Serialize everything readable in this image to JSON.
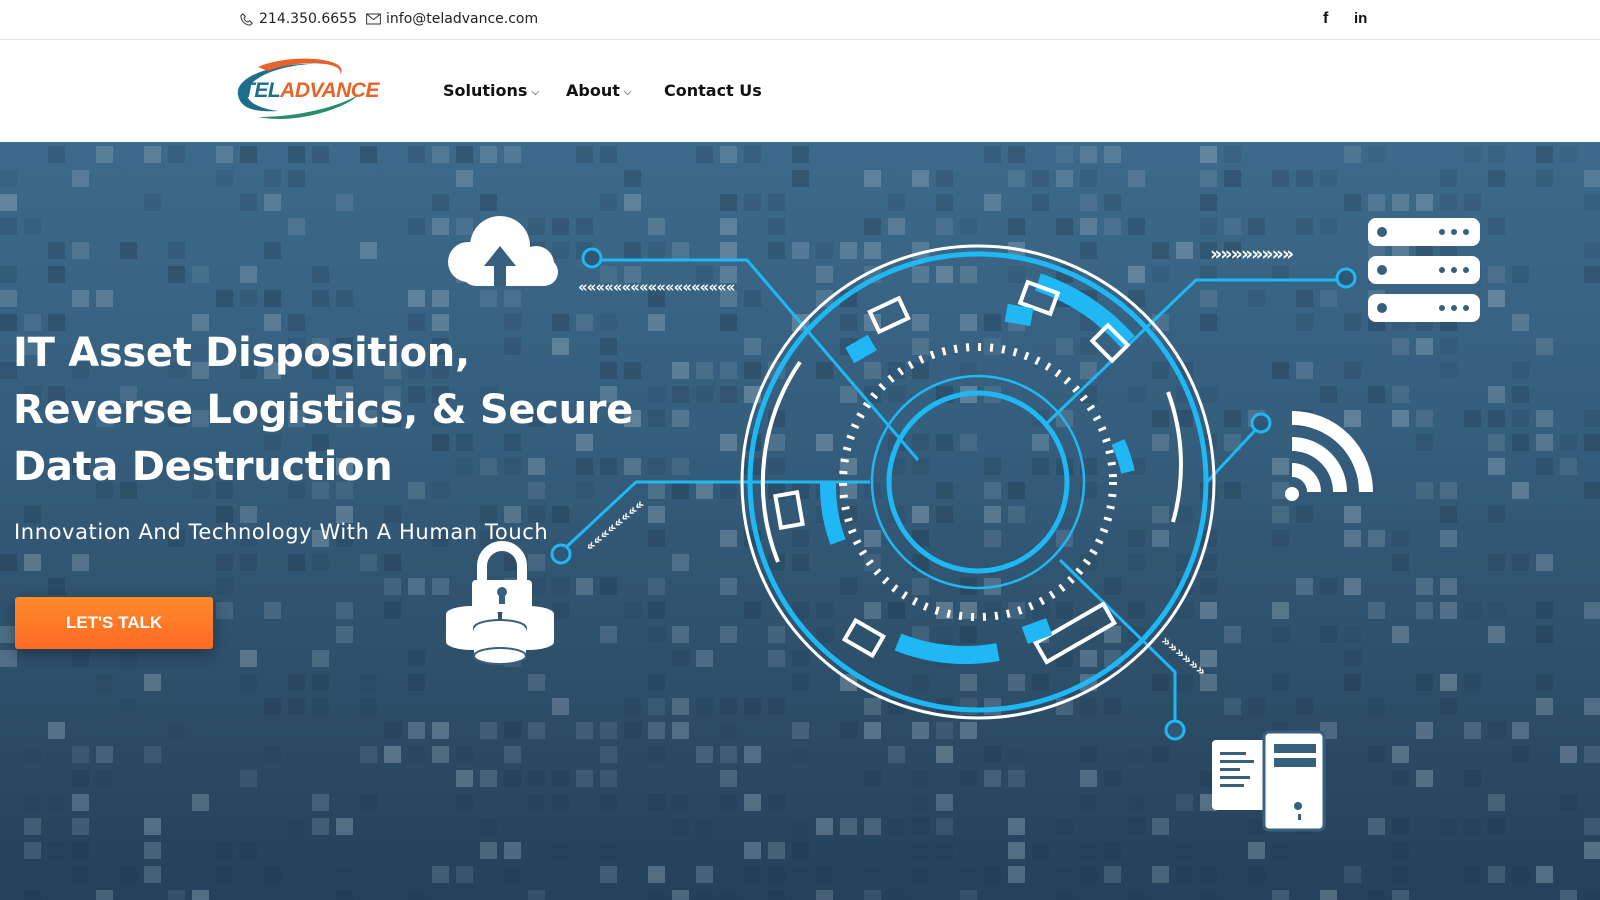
{
  "topbar": {
    "phone": "214.350.6655",
    "email": "info@teladvance.com",
    "social": {
      "facebook_glyph": "f",
      "linkedin_glyph": "in"
    }
  },
  "logo": {
    "tel": "TEL",
    "advance": "ADVANCE"
  },
  "nav": {
    "items": [
      {
        "label": "Solutions",
        "has_dropdown": true
      },
      {
        "label": "About",
        "has_dropdown": true
      },
      {
        "label": "Contact Us",
        "has_dropdown": false
      }
    ],
    "chevron_glyph": "⌵"
  },
  "hero": {
    "title": "IT Asset Disposition, Reverse Logistics, & Secure Data Destruction",
    "subtitle": "Innovation And Technology With A Human Touch",
    "cta_label": "LET'S TALK"
  },
  "colors": {
    "accent_blue": "#1fb8f5",
    "orange": "#ff7324",
    "logo_teal": "#1c6e8c",
    "logo_orange": "#e8632a"
  },
  "icons": [
    "phone-icon",
    "mail-icon",
    "facebook-icon",
    "linkedin-icon",
    "cloud-upload-icon",
    "server-rack-icon",
    "wifi-icon",
    "lock-database-icon",
    "desktop-computer-icon"
  ]
}
